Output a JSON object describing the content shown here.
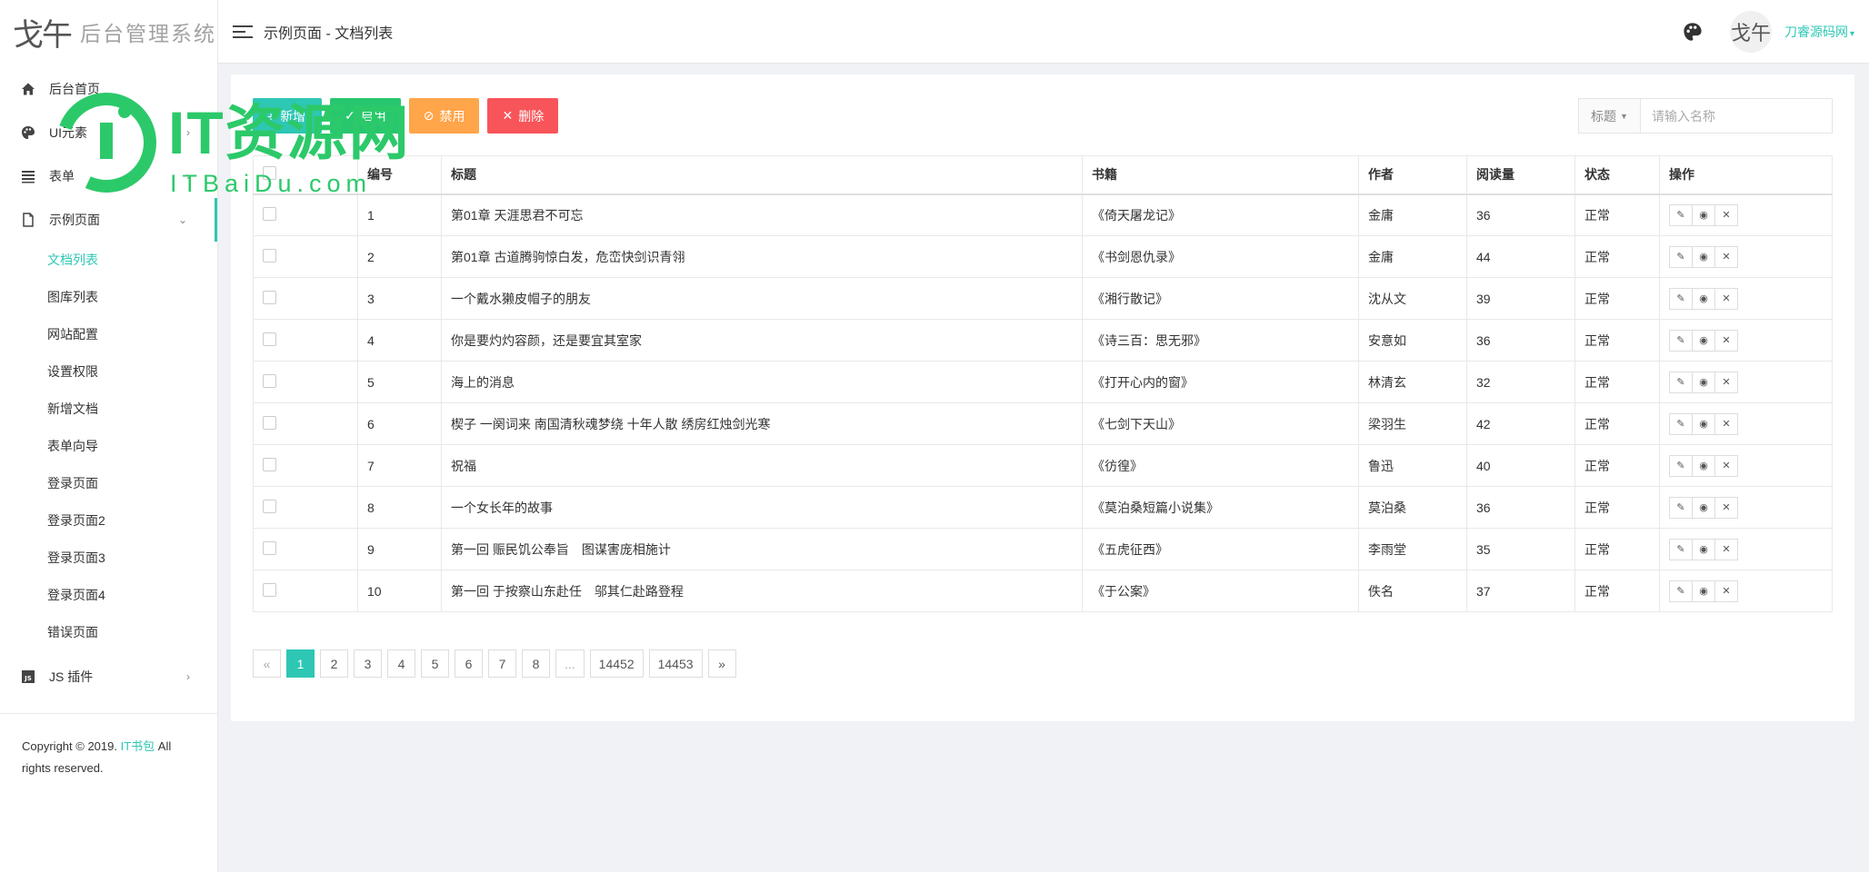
{
  "app": {
    "logo_mark": "戈午",
    "logo_text": "后台管理系统"
  },
  "colors": {
    "accent": "#2ec7b4",
    "success": "#28c76f",
    "warning": "#ffa54a",
    "danger": "#f7555a"
  },
  "sidebar": {
    "items": [
      {
        "label": "后台首页",
        "icon": "home-icon"
      },
      {
        "label": "UI元素",
        "icon": "palette-icon"
      },
      {
        "label": "表单",
        "icon": "list-icon"
      },
      {
        "label": "示例页面",
        "icon": "file-icon"
      }
    ],
    "submenu": [
      {
        "label": "文档列表",
        "active": true
      },
      {
        "label": "图库列表"
      },
      {
        "label": "网站配置"
      },
      {
        "label": "设置权限"
      },
      {
        "label": "新增文档"
      },
      {
        "label": "表单向导"
      },
      {
        "label": "登录页面"
      },
      {
        "label": "登录页面2"
      },
      {
        "label": "登录页面3"
      },
      {
        "label": "登录页面4"
      },
      {
        "label": "错误页面"
      }
    ],
    "plugins_label": "JS 插件",
    "copyright_prefix": "Copyright © 2019.",
    "copyright_brand": "IT书包",
    "copyright_suffix": "All rights reserved."
  },
  "header": {
    "breadcrumb": "示例页面 - 文档列表",
    "avatar_text": "戈午",
    "user_name": "刀睿源码网"
  },
  "toolbar": {
    "add_label": "新增",
    "enable_label": "启用",
    "disable_label": "禁用",
    "delete_label": "删除"
  },
  "search": {
    "field_label": "标题",
    "placeholder": "请输入名称"
  },
  "table": {
    "headers": {
      "id": "编号",
      "title": "标题",
      "book": "书籍",
      "author": "作者",
      "reads": "阅读量",
      "status": "状态",
      "ops": "操作"
    },
    "rows": [
      {
        "id": "1",
        "title": "第01章 天涯思君不可忘",
        "book": "《倚天屠龙记》",
        "author": "金庸",
        "reads": "36",
        "status": "正常"
      },
      {
        "id": "2",
        "title": "第01章 古道腾驹惊白发，危峦快剑识青翎",
        "book": "《书剑恩仇录》",
        "author": "金庸",
        "reads": "44",
        "status": "正常"
      },
      {
        "id": "3",
        "title": "一个戴水獭皮帽子的朋友",
        "book": "《湘行散记》",
        "author": "沈从文",
        "reads": "39",
        "status": "正常"
      },
      {
        "id": "4",
        "title": "你是要灼灼容颜，还是要宜其室家",
        "book": "《诗三百：思无邪》",
        "author": "安意如",
        "reads": "36",
        "status": "正常"
      },
      {
        "id": "5",
        "title": "海上的消息",
        "book": "《打开心内的窗》",
        "author": "林清玄",
        "reads": "32",
        "status": "正常"
      },
      {
        "id": "6",
        "title": "楔子 一阕词来 南国清秋魂梦绕 十年人散 绣房红烛剑光寒",
        "book": "《七剑下天山》",
        "author": "梁羽生",
        "reads": "42",
        "status": "正常"
      },
      {
        "id": "7",
        "title": "祝福",
        "book": "《彷徨》",
        "author": "鲁迅",
        "reads": "40",
        "status": "正常"
      },
      {
        "id": "8",
        "title": "一个女长年的故事",
        "book": "《莫泊桑短篇小说集》",
        "author": "莫泊桑",
        "reads": "36",
        "status": "正常"
      },
      {
        "id": "9",
        "title": "第一回 赈民饥公奉旨　图谋害庞相施计",
        "book": "《五虎征西》",
        "author": "李雨堂",
        "reads": "35",
        "status": "正常"
      },
      {
        "id": "10",
        "title": "第一回 于按察山东赴任　邬其仁赴路登程",
        "book": "《于公案》",
        "author": "佚名",
        "reads": "37",
        "status": "正常"
      }
    ]
  },
  "pagination": {
    "prev": "«",
    "next": "»",
    "pages": [
      "1",
      "2",
      "3",
      "4",
      "5",
      "6",
      "7",
      "8",
      "...",
      "14452",
      "14453"
    ],
    "current": "1"
  },
  "watermark": {
    "text": "IT资源网",
    "sub": "ITBaiDu.com"
  }
}
